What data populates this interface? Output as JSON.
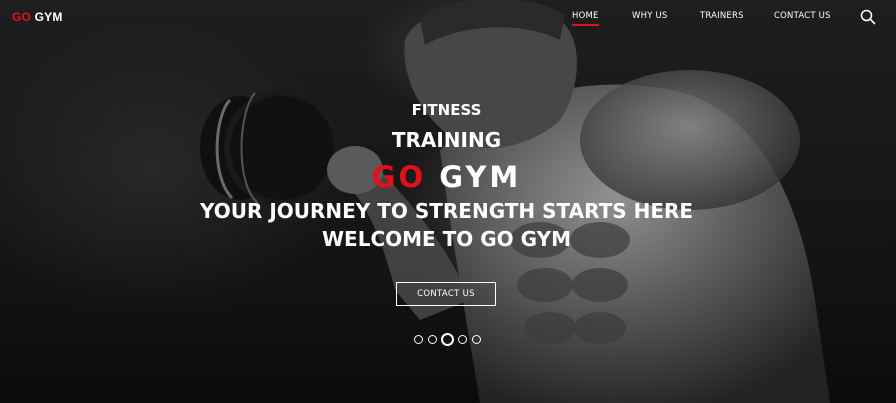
{
  "brand": {
    "accent": "GO",
    "name": "GYM"
  },
  "nav": {
    "items": [
      {
        "label": "HOME",
        "active": true
      },
      {
        "label": "WHY US",
        "active": false
      },
      {
        "label": "TRAINERS",
        "active": false
      },
      {
        "label": "CONTACT US",
        "active": false
      }
    ],
    "search_icon": "search-icon"
  },
  "hero": {
    "line1": "FITNESS",
    "line2": "TRAINING",
    "brand_accent": "GO",
    "brand_name": "GYM",
    "tagline1": "YOUR JOURNEY TO STRENGTH STARTS HERE",
    "tagline2": "WELCOME TO GO GYM",
    "cta_label": "CONTACT US"
  },
  "slider": {
    "count": 5,
    "active_index": 2
  },
  "colors": {
    "accent": "#e3101b",
    "text": "#ffffff",
    "background": "#161616"
  }
}
